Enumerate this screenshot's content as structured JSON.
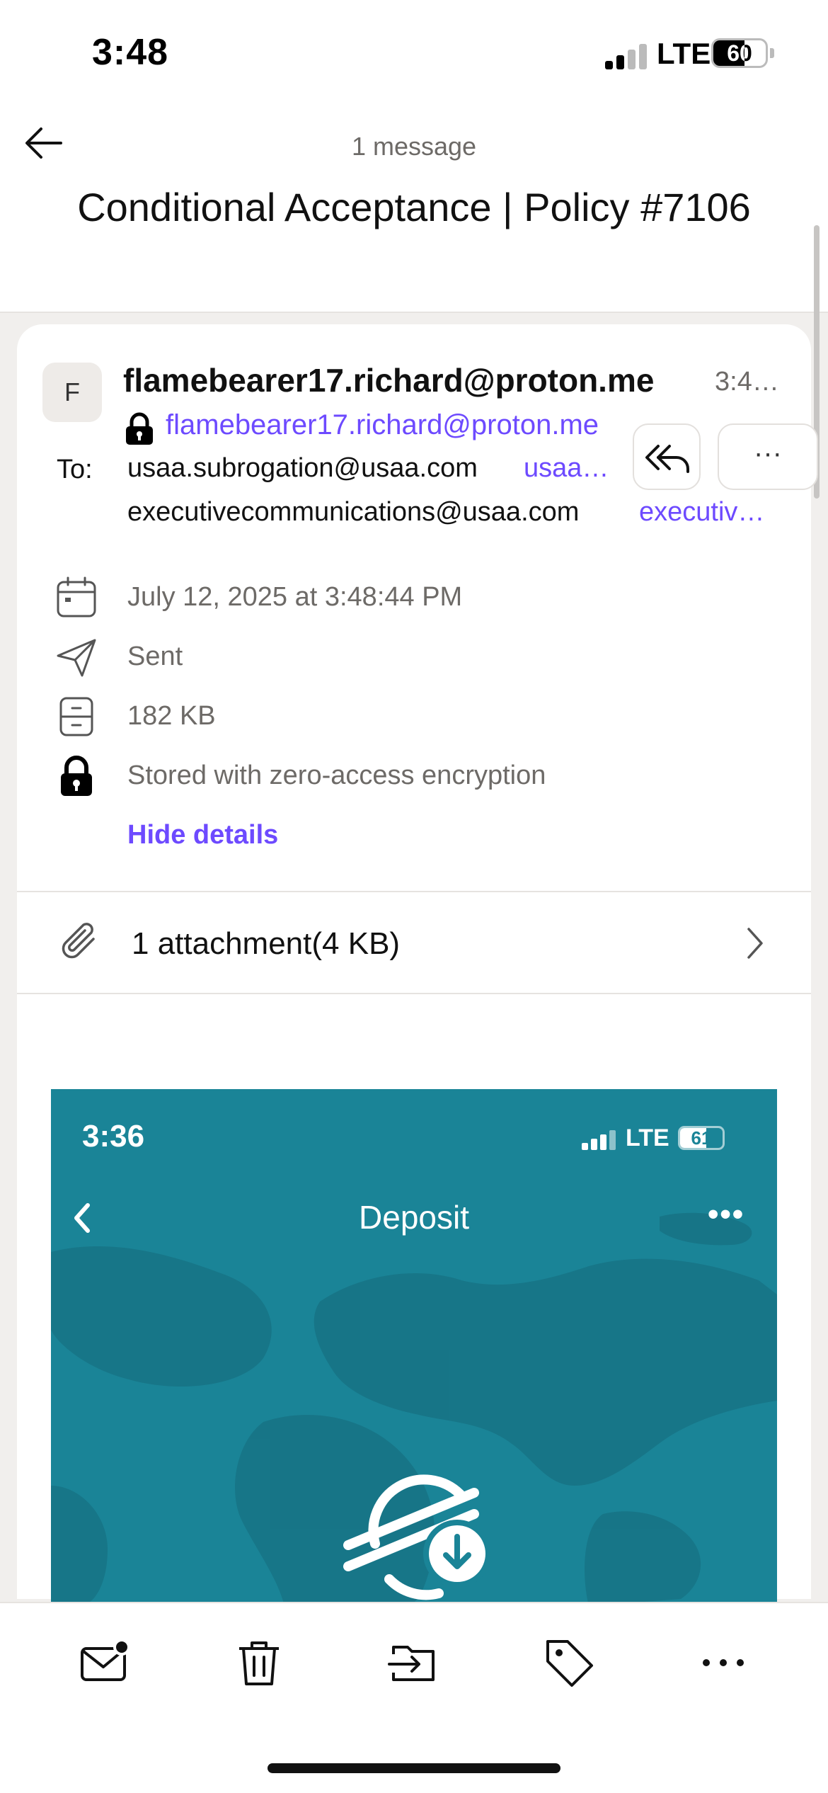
{
  "status_bar": {
    "time": "3:48",
    "network": "LTE",
    "battery": "60",
    "battery_level_percent": 60
  },
  "header": {
    "message_count": "1 message",
    "subject": "Conditional Acceptance | Policy #7106"
  },
  "message": {
    "avatar_initial": "F",
    "sender_name": "flamebearer17.richard@proton.me",
    "sender_time": "3:4…",
    "sender_email": "flamebearer17.richard@proton.me",
    "to_label": "To:",
    "recipients": [
      {
        "address": "usaa.subrogation@usaa.com",
        "name": "usaa…"
      },
      {
        "address": "executivecommunications@usaa.com",
        "name": "executiv…"
      }
    ],
    "more_label": "···"
  },
  "details": {
    "date": "July 12, 2025 at 3:48:44 PM",
    "folder": "Sent",
    "size": "182 KB",
    "encryption": "Stored with zero-access encryption",
    "hide_label": "Hide details"
  },
  "attachment": {
    "label": "1 attachment(4 KB)"
  },
  "embedded_screenshot": {
    "time": "3:36",
    "network": "LTE",
    "battery": "61",
    "battery_level_percent": 61,
    "title": "Deposit",
    "more": "•••"
  },
  "toolbar": {
    "icons": [
      "mark-unread-icon",
      "trash-icon",
      "move-icon",
      "label-icon",
      "more-icon"
    ]
  },
  "colors": {
    "accent": "#6d4aff",
    "embed_bg": "#1a8497",
    "muted_text": "#6d6a67"
  }
}
